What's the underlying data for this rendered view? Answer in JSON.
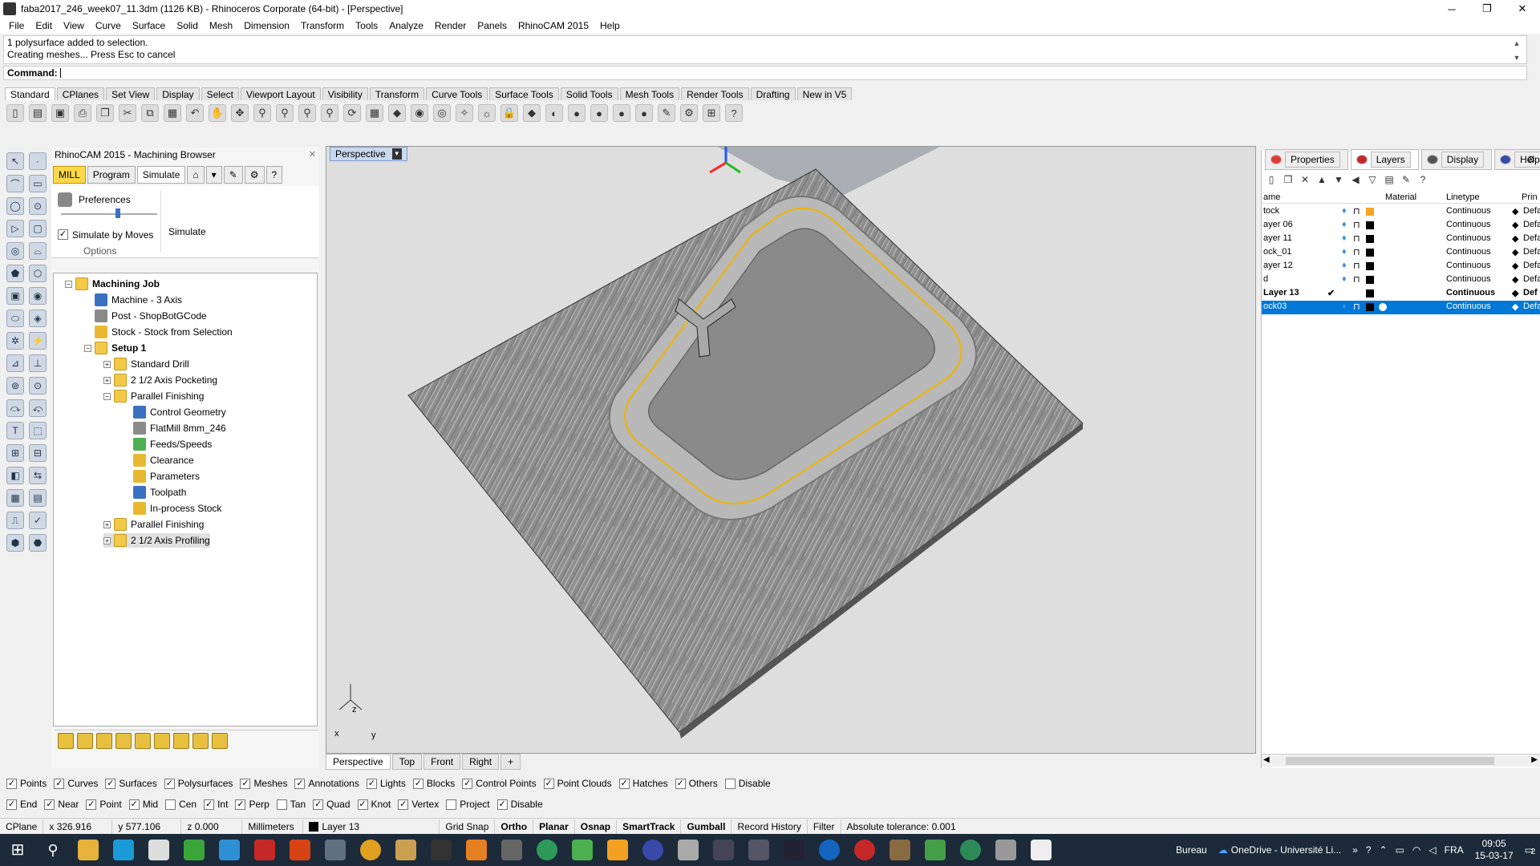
{
  "window": {
    "title": "faba2017_246_week07_11.3dm (1126 KB) - Rhinoceros Corporate (64-bit) - [Perspective]"
  },
  "menu": [
    "File",
    "Edit",
    "View",
    "Curve",
    "Surface",
    "Solid",
    "Mesh",
    "Dimension",
    "Transform",
    "Tools",
    "Analyze",
    "Render",
    "Panels",
    "RhinoCAM 2015",
    "Help"
  ],
  "command": {
    "history_1": "1 polysurface added to selection.",
    "history_2": "Creating meshes... Press Esc to cancel",
    "label": "Command:"
  },
  "toolbar_tabs": [
    "Standard",
    "CPlanes",
    "Set View",
    "Display",
    "Select",
    "Viewport Layout",
    "Visibility",
    "Transform",
    "Curve Tools",
    "Surface Tools",
    "Solid Tools",
    "Mesh Tools",
    "Render Tools",
    "Drafting",
    "New in V5"
  ],
  "browser": {
    "title": "RhinoCAM 2015 - Machining Browser",
    "tabs": {
      "mill": "MILL",
      "program": "Program",
      "simulate": "Simulate"
    },
    "preferences": "Preferences",
    "simulate_by_moves": "Simulate by Moves",
    "simulate": "Simulate",
    "options": "Options",
    "tree": [
      {
        "label": "Machining Job",
        "level": 0,
        "icon": "folder",
        "exp": "−",
        "bold": true
      },
      {
        "label": "Machine - 3 Axis",
        "level": 1,
        "icon": "blue"
      },
      {
        "label": "Post - ShopBotGCode",
        "level": 1,
        "icon": "gray"
      },
      {
        "label": "Stock - Stock from Selection",
        "level": 1,
        "icon": "yel"
      },
      {
        "label": "Setup 1",
        "level": 1,
        "icon": "folder",
        "exp": "−",
        "bold": true
      },
      {
        "label": "Standard Drill",
        "level": 2,
        "icon": "folder",
        "exp": "+"
      },
      {
        "label": "2 1/2 Axis Pocketing",
        "level": 2,
        "icon": "folder",
        "exp": "+"
      },
      {
        "label": "Parallel Finishing",
        "level": 2,
        "icon": "folder",
        "exp": "−"
      },
      {
        "label": "Control Geometry",
        "level": 3,
        "icon": "blue"
      },
      {
        "label": "FlatMill 8mm_246",
        "level": 3,
        "icon": "gray"
      },
      {
        "label": "Feeds/Speeds",
        "level": 3,
        "icon": "green"
      },
      {
        "label": "Clearance",
        "level": 3,
        "icon": "yel"
      },
      {
        "label": "Parameters",
        "level": 3,
        "icon": "yel"
      },
      {
        "label": "Toolpath",
        "level": 3,
        "icon": "blue"
      },
      {
        "label": "In-process Stock",
        "level": 3,
        "icon": "yel"
      },
      {
        "label": "Parallel Finishing",
        "level": 2,
        "icon": "folder",
        "exp": "+"
      },
      {
        "label": "2 1/2 Axis Profiling",
        "level": 2,
        "icon": "folder",
        "exp": "+",
        "selected": true
      }
    ]
  },
  "viewport": {
    "title": "Perspective",
    "tabs": [
      "Perspective",
      "Top",
      "Front",
      "Right"
    ],
    "axis": {
      "x": "x",
      "y": "y",
      "z": "z"
    }
  },
  "right_panel": {
    "tabs": [
      "Properties",
      "Layers",
      "Display",
      "Help"
    ],
    "columns": {
      "name": "ame",
      "material": "Material",
      "linetype": "Linetype",
      "print": "Prin"
    },
    "layers": [
      {
        "name": "tock",
        "linetype": "Continuous",
        "print": "Defa",
        "color": "#f5a623"
      },
      {
        "name": "ayer 06",
        "linetype": "Continuous",
        "print": "Defa",
        "color": "#000000"
      },
      {
        "name": "ayer 11",
        "linetype": "Continuous",
        "print": "Defa",
        "color": "#000000"
      },
      {
        "name": "ock_01",
        "linetype": "Continuous",
        "print": "Defa",
        "color": "#000000"
      },
      {
        "name": "ayer 12",
        "linetype": "Continuous",
        "print": "Defa",
        "color": "#000000"
      },
      {
        "name": "d",
        "linetype": "Continuous",
        "print": "Defa",
        "color": "#000000"
      },
      {
        "name": "Layer 13",
        "linetype": "Continuous",
        "print": "Def",
        "color": "#000000",
        "bold": true,
        "check": "✔"
      },
      {
        "name": "ock03",
        "linetype": "Continuous",
        "print": "Defa",
        "color": "#000000",
        "selected": true
      }
    ]
  },
  "filters_1": [
    {
      "label": "Points",
      "checked": true
    },
    {
      "label": "Curves",
      "checked": true
    },
    {
      "label": "Surfaces",
      "checked": true
    },
    {
      "label": "Polysurfaces",
      "checked": true
    },
    {
      "label": "Meshes",
      "checked": true
    },
    {
      "label": "Annotations",
      "checked": true
    },
    {
      "label": "Lights",
      "checked": true
    },
    {
      "label": "Blocks",
      "checked": true
    },
    {
      "label": "Control Points",
      "checked": true
    },
    {
      "label": "Point Clouds",
      "checked": true
    },
    {
      "label": "Hatches",
      "checked": true
    },
    {
      "label": "Others",
      "checked": true
    },
    {
      "label": "Disable",
      "checked": false
    }
  ],
  "filters_2": [
    {
      "label": "End",
      "checked": true
    },
    {
      "label": "Near",
      "checked": true
    },
    {
      "label": "Point",
      "checked": true
    },
    {
      "label": "Mid",
      "checked": true
    },
    {
      "label": "Cen",
      "checked": false
    },
    {
      "label": "Int",
      "checked": true
    },
    {
      "label": "Perp",
      "checked": true
    },
    {
      "label": "Tan",
      "checked": false
    },
    {
      "label": "Quad",
      "checked": true
    },
    {
      "label": "Knot",
      "checked": true
    },
    {
      "label": "Vertex",
      "checked": true
    },
    {
      "label": "Project",
      "checked": false
    },
    {
      "label": "Disable",
      "checked": true
    }
  ],
  "status": {
    "cplane": "CPlane",
    "x": "x 326.916",
    "y": "y 577.106",
    "z": "z 0.000",
    "units": "Millimeters",
    "layer": "Layer 13",
    "grid_snap": "Grid Snap",
    "ortho": "Ortho",
    "planar": "Planar",
    "osnap": "Osnap",
    "smarttrack": "SmartTrack",
    "gumball": "Gumball",
    "record_history": "Record History",
    "filter": "Filter",
    "tolerance": "Absolute tolerance: 0.001"
  },
  "taskbar": {
    "desktop": "Bureau",
    "onedrive": "OneDrive - Université Li...",
    "lang": "FRA",
    "time": "09:05",
    "date": "15-03-17",
    "notif": "2"
  }
}
